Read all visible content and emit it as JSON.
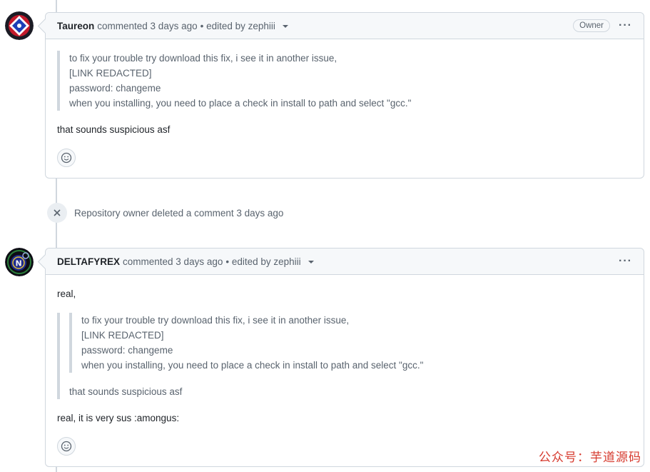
{
  "comments": [
    {
      "author": "Taureon",
      "action": "commented 3 days ago",
      "edited_text": "• edited by zephiii",
      "badge": "Owner",
      "quote_lines": [
        "to fix your trouble try download this fix, i see it in another issue,",
        "[LINK REDACTED]",
        "password: changeme",
        "when you installing, you need to place a check in install to path and select \"gcc.\""
      ],
      "body": "that sounds suspicious asf"
    },
    {
      "author": "DELTAFYREX",
      "action": "commented 3 days ago",
      "edited_text": "• edited by zephiii",
      "intro": "real,",
      "nested_quote_lines": [
        "to fix your trouble try download this fix, i see it in another issue,",
        "[LINK REDACTED]",
        "password: changeme",
        "when you installing, you need to place a check in install to path and select \"gcc.\""
      ],
      "quote_reply": "that sounds suspicious asf",
      "body": "real, it is very sus :amongus:"
    }
  ],
  "event": {
    "text": "Repository owner deleted a comment 3 days ago"
  },
  "watermark": "公众号：芋道源码",
  "colors": {
    "border": "#d0d7de",
    "header_bg": "#f6f8fa",
    "muted_text": "#59636e",
    "watermark": "#d63a2e"
  }
}
